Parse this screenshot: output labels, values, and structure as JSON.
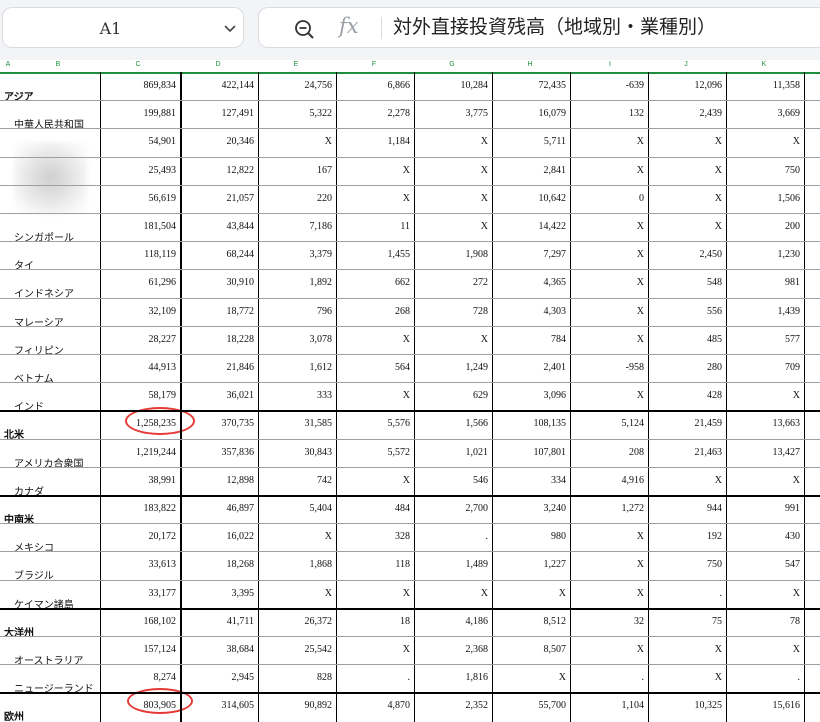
{
  "name_box": {
    "value": "A1"
  },
  "formula_bar": {
    "text": "対外直接投資残高（地域別・業種別）"
  },
  "columns": [
    "A",
    "B",
    "C",
    "D",
    "E",
    "F",
    "G",
    "H",
    "I",
    "J",
    "K"
  ],
  "rows": [
    {
      "label": "アジア",
      "bold": true,
      "values": [
        "869,834",
        "422,144",
        "24,756",
        "6,866",
        "10,284",
        "72,435",
        "-639",
        "12,096",
        "11,358"
      ]
    },
    {
      "label": "中華人民共和国",
      "bold": false,
      "values": [
        "199,881",
        "127,491",
        "5,322",
        "2,278",
        "3,775",
        "16,079",
        "132",
        "2,439",
        "3,669"
      ]
    },
    {
      "label": "",
      "bold": false,
      "values": [
        "54,901",
        "20,346",
        "X",
        "1,184",
        "X",
        "5,711",
        "X",
        "X",
        "X"
      ]
    },
    {
      "label": "",
      "bold": false,
      "values": [
        "25,493",
        "12,822",
        "167",
        "X",
        "X",
        "2,841",
        "X",
        "X",
        "750"
      ]
    },
    {
      "label": "",
      "bold": false,
      "values": [
        "56,619",
        "21,057",
        "220",
        "X",
        "X",
        "10,642",
        "0",
        "X",
        "1,506"
      ]
    },
    {
      "label": "シンガポール",
      "bold": false,
      "values": [
        "181,504",
        "43,844",
        "7,186",
        "11",
        "X",
        "14,422",
        "X",
        "X",
        "200"
      ]
    },
    {
      "label": "タイ",
      "bold": false,
      "values": [
        "118,119",
        "68,244",
        "3,379",
        "1,455",
        "1,908",
        "7,297",
        "X",
        "2,450",
        "1,230"
      ]
    },
    {
      "label": "インドネシア",
      "bold": false,
      "values": [
        "61,296",
        "30,910",
        "1,892",
        "662",
        "272",
        "4,365",
        "X",
        "548",
        "981"
      ]
    },
    {
      "label": "マレーシア",
      "bold": false,
      "values": [
        "32,109",
        "18,772",
        "796",
        "268",
        "728",
        "4,303",
        "X",
        "556",
        "1,439"
      ]
    },
    {
      "label": "フィリピン",
      "bold": false,
      "values": [
        "28,227",
        "18,228",
        "3,078",
        "X",
        "X",
        "784",
        "X",
        "485",
        "577"
      ]
    },
    {
      "label": "ベトナム",
      "bold": false,
      "values": [
        "44,913",
        "21,846",
        "1,612",
        "564",
        "1,249",
        "2,401",
        "-958",
        "280",
        "709"
      ]
    },
    {
      "label": "インド",
      "bold": false,
      "values": [
        "58,179",
        "36,021",
        "333",
        "X",
        "629",
        "3,096",
        "X",
        "428",
        "X"
      ]
    },
    {
      "label": "北米",
      "bold": true,
      "values": [
        "1,258,235",
        "370,735",
        "31,585",
        "5,576",
        "1,566",
        "108,135",
        "5,124",
        "21,459",
        "13,663"
      ]
    },
    {
      "label": "アメリカ合衆国",
      "bold": false,
      "values": [
        "1,219,244",
        "357,836",
        "30,843",
        "5,572",
        "1,021",
        "107,801",
        "208",
        "21,463",
        "13,427"
      ]
    },
    {
      "label": "カナダ",
      "bold": false,
      "values": [
        "38,991",
        "12,898",
        "742",
        "X",
        "546",
        "334",
        "4,916",
        "X",
        "X"
      ]
    },
    {
      "label": "中南米",
      "bold": true,
      "values": [
        "183,822",
        "46,897",
        "5,404",
        "484",
        "2,700",
        "3,240",
        "1,272",
        "944",
        "991"
      ]
    },
    {
      "label": "メキシコ",
      "bold": false,
      "values": [
        "20,172",
        "16,022",
        "X",
        "328",
        ".",
        "980",
        "X",
        "192",
        "430"
      ]
    },
    {
      "label": "ブラジル",
      "bold": false,
      "values": [
        "33,613",
        "18,268",
        "1,868",
        "118",
        "1,489",
        "1,227",
        "X",
        "750",
        "547"
      ]
    },
    {
      "label": "ケイマン諸島",
      "bold": false,
      "values": [
        "33,177",
        "3,395",
        "X",
        "X",
        "X",
        "X",
        "X",
        ".",
        "X"
      ]
    },
    {
      "label": "大洋州",
      "bold": true,
      "values": [
        "168,102",
        "41,711",
        "26,372",
        "18",
        "4,186",
        "8,512",
        "32",
        "75",
        "78"
      ]
    },
    {
      "label": "オーストラリア",
      "bold": false,
      "values": [
        "157,124",
        "38,684",
        "25,542",
        "X",
        "2,368",
        "8,507",
        "X",
        "X",
        "X"
      ]
    },
    {
      "label": "ニュージーランド",
      "bold": false,
      "values": [
        "8,274",
        "2,945",
        "828",
        ".",
        "1,816",
        "X",
        ".",
        "X",
        "."
      ]
    },
    {
      "label": "欧州",
      "bold": true,
      "values": [
        "803,905",
        "314,605",
        "90,892",
        "4,870",
        "2,352",
        "55,700",
        "1,104",
        "10,325",
        "15,616"
      ]
    }
  ]
}
